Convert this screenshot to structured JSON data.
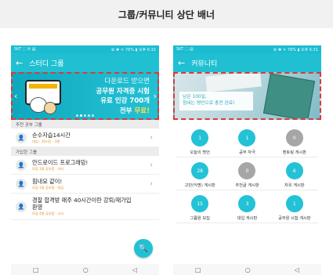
{
  "page_title": "그룹/커뮤니티 상단 배너",
  "left": {
    "status": {
      "left": "SKT ⬚ ✉ ▤",
      "right": "⚙ ✱ ᯤ 76% ▮ 오후 6:32"
    },
    "appbar_title": "스터디 그룹",
    "banner": {
      "line1": "다운로드 받으면",
      "line2": "공무원 자격증 시험",
      "line3": "유료 인강 700개",
      "line4_a": "전부 ",
      "line4_b": "무료!"
    },
    "section1": "추천 공부 그룹",
    "row1": {
      "title": "순수자습14시간",
      "sub": "대입 · 10시간 · 3명"
    },
    "section2": "가입한 그룹",
    "row2": {
      "title": "안드로이드 프로그래밍!",
      "sub": "모집 1명 공부함 · 기타"
    },
    "row3": {
      "title": "힘내요 같이!",
      "sub": "모집 1명 공부함 · 대입"
    },
    "row4": {
      "title": "경찰 합격방 매주 40시간이란 강퇴/재가입 환영",
      "sub": "모집 4명 공부함 · 고시"
    }
  },
  "right": {
    "status": {
      "left": "SKT ⬚ ▤",
      "right": "⚙ ✱ ᯤ 76% ▮ 오후 6:31"
    },
    "appbar_title": "커뮤니티",
    "banner": {
      "line1": "남은 100일,",
      "line2": "힘내는 명언으로 충전 완료!"
    },
    "grid": [
      {
        "value": "1",
        "label": "오늘의 명언",
        "color": "teal"
      },
      {
        "value": "1",
        "label": "공부 자극",
        "color": "teal"
      },
      {
        "value": "0",
        "label": "멘토링 게시판",
        "color": "gray"
      },
      {
        "value": "28",
        "label": "고민(익명) 게시판",
        "color": "teal"
      },
      {
        "value": "0",
        "label": "추천글 게시판",
        "color": "gray"
      },
      {
        "value": "6",
        "label": "자유 게시판",
        "color": "teal"
      },
      {
        "value": "15",
        "label": "그룹원 모집",
        "color": "teal"
      },
      {
        "value": "3",
        "label": "대입 게시판",
        "color": "teal"
      },
      {
        "value": "1",
        "label": "공무원 시험 게시판",
        "color": "teal"
      }
    ]
  },
  "nav": {
    "square": "□",
    "circle": "○",
    "back": "◁"
  },
  "icons": {
    "back": "←",
    "chevron": "›",
    "search": "🔍",
    "arrow_left": "‹",
    "arrow_right": "›"
  },
  "colors": {
    "teal": "#20c0d2",
    "gray": "#a6a6a6",
    "highlight_border": "#d83a3a"
  }
}
